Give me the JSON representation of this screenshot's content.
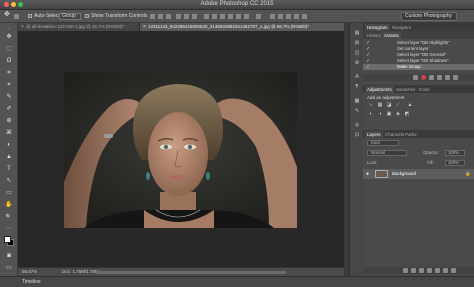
{
  "window": {
    "title": "Adobe Photoshop CC 2015"
  },
  "options": {
    "auto_select_label": "Auto-Select:",
    "auto_select_value": "Group",
    "show_transform_label": "Show Transform Controls",
    "workspace": "Custom Photography"
  },
  "tools": [
    "✥",
    "⬚",
    "ʘ",
    "⌗",
    "⌖",
    "✎",
    "✐",
    "⊕",
    "⌘",
    "◐",
    "▲",
    "T",
    "↖",
    "▭",
    "✋",
    "🔍"
  ],
  "document": {
    "tabs": [
      {
        "label": "@ all-levitation-123-0d0-2.jpg @ 16.7% (RGB/8)*"
      },
      {
        "label": "12311143_842286425800620_2146934982341462707_o.jpg @ 66.7% (RGB/8)*"
      }
    ],
    "zoom": "66.67%",
    "doc_size": "Doc: 1.76M/1.76M"
  },
  "timeline_label": "Timeline",
  "panels": {
    "top_tabs": [
      "Histogram",
      "Navigator"
    ],
    "sub_tabs": [
      "History",
      "Actions"
    ],
    "actions": [
      {
        "check": "✓",
        "label": "Select layer \"DB Highlights\"",
        "selected": false
      },
      {
        "check": "✓",
        "label": "Set current layer",
        "selected": false
      },
      {
        "check": "✓",
        "label": "Select layer \"DB General\"",
        "selected": false
      },
      {
        "check": "✓",
        "label": "Select layer \"DB Shadows\"",
        "selected": false
      },
      {
        "check": "✓",
        "label": "Make Group",
        "selected": true
      }
    ],
    "adjust_tabs": [
      "Adjustments",
      "Swatches",
      "Color"
    ],
    "adjust_subtitle": "Add an adjustment",
    "layers_tabs": [
      "Layers",
      "Channels",
      "Paths"
    ],
    "layer_kind": "Kind",
    "blend_mode": "Normal",
    "opacity_label": "Opacity:",
    "opacity_value": "100%",
    "lock_label": "Lock:",
    "fill_label": "Fill:",
    "fill_value": "100%",
    "layer_name": "Background",
    "strip_icons": [
      "▤",
      "⊞",
      "◫",
      "⚙",
      "A",
      "¶",
      "▦",
      "✎",
      "◎",
      "⊡"
    ],
    "adjust_icons": [
      "☼",
      "▦",
      "◪",
      "⟋",
      "▲",
      "◐",
      "◑",
      "▣",
      "◈",
      "◩"
    ]
  },
  "colors": {
    "panel": "#4a4a4a",
    "canvas_bg": "#282828",
    "selected_row": "#6c6c6c"
  }
}
